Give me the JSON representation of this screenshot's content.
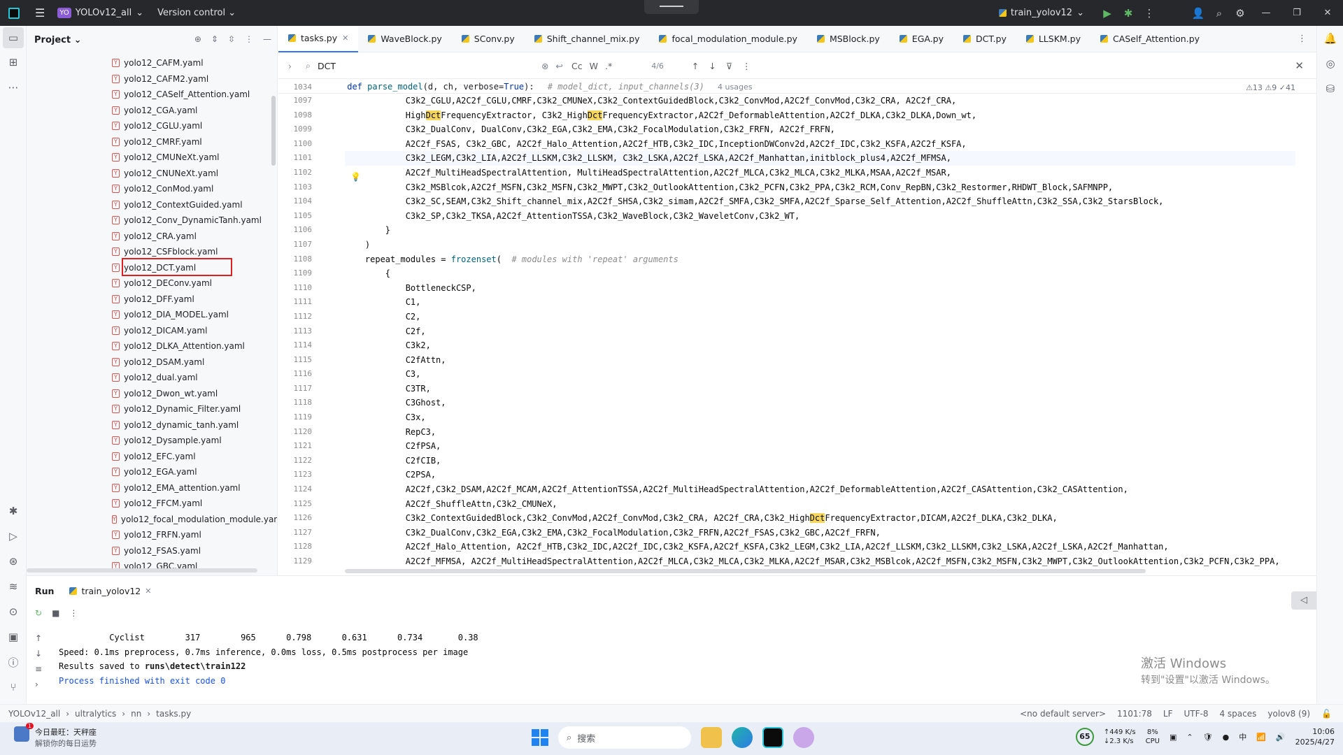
{
  "titlebar": {
    "project_badge": "YO",
    "project": "YOLOv12_all",
    "version_control": "Version control",
    "run_config": "train_yolov12"
  },
  "project_panel": {
    "title": "Project",
    "files": [
      "yolo12_CAFM.yaml",
      "yolo12_CAFM2.yaml",
      "yolo12_CASelf_Attention.yaml",
      "yolo12_CGA.yaml",
      "yolo12_CGLU.yaml",
      "yolo12_CMRF.yaml",
      "yolo12_CMUNeXt.yaml",
      "yolo12_CNUNeXt.yaml",
      "yolo12_ConMod.yaml",
      "yolo12_ContextGuided.yaml",
      "yolo12_Conv_DynamicTanh.yaml",
      "yolo12_CRA.yaml",
      "yolo12_CSFblock.yaml",
      "yolo12_DCT.yaml",
      "yolo12_DEConv.yaml",
      "yolo12_DFF.yaml",
      "yolo12_DIA_MODEL.yaml",
      "yolo12_DICAM.yaml",
      "yolo12_DLKA_Attention.yaml",
      "yolo12_DSAM.yaml",
      "yolo12_dual.yaml",
      "yolo12_Dwon_wt.yaml",
      "yolo12_Dynamic_Filter.yaml",
      "yolo12_dynamic_tanh.yaml",
      "yolo12_Dysample.yaml",
      "yolo12_EFC.yaml",
      "yolo12_EGA.yaml",
      "yolo12_EMA_attention.yaml",
      "yolo12_FFCM.yaml",
      "yolo12_focal_modulation_module.yaml",
      "yolo12_FRFN.yaml",
      "yolo12_FSAS.yaml",
      "yolo12_GBC.yaml"
    ]
  },
  "tabs": [
    "tasks.py",
    "WaveBlock.py",
    "SConv.py",
    "Shift_channel_mix.py",
    "focal_modulation_module.py",
    "MSBlock.py",
    "EGA.py",
    "DCT.py",
    "LLSKM.py",
    "CASelf_Attention.py"
  ],
  "search": {
    "query": "DCT",
    "count": "4/6",
    "cc": "Cc",
    "w": "W",
    "regex": ".*"
  },
  "editor": {
    "sticky_line": "1034",
    "sticky_def": "def",
    "sticky_fn": "parse_model",
    "sticky_args": "(d, ch, verbose=",
    "sticky_true": "True",
    "sticky_close": "):",
    "sticky_comment": "# model_dict, input_channels(3)",
    "usages": "4 usages",
    "inspections": "⚠13  ⚠9  ✓41",
    "line_numbers": [
      "1097",
      "1098",
      "1099",
      "1100",
      "1101",
      "1102",
      "1103",
      "1104",
      "1105",
      "1106",
      "1107",
      "1108",
      "1109",
      "1110",
      "1111",
      "1112",
      "1113",
      "1114",
      "1115",
      "1116",
      "1117",
      "1118",
      "1119",
      "1120",
      "1121",
      "1122",
      "1123",
      "1124",
      "1125",
      "1126",
      "1127",
      "1128",
      "1129"
    ],
    "lines": [
      "            C3k2_CGLU,A2C2f_CGLU,CMRF,C3k2_CMUNeX,C3k2_ContextGuidedBlock,C3k2_ConvMod,A2C2f_ConvMod,C3k2_CRA, A2C2f_CRA,",
      "            HighDctFrequencyExtractor, C3k2_HighDctFrequencyExtractor,A2C2f_DeformableAttention,A2C2f_DLKA,C3k2_DLKA,Down_wt,",
      "            C3k2_DualConv, DualConv,C3k2_EGA,C3k2_EMA,C3k2_FocalModulation,C3k2_FRFN, A2C2f_FRFN,",
      "            A2C2f_FSAS, C3k2_GBC, A2C2f_Halo_Attention,A2C2f_HTB,C3k2_IDC,InceptionDWConv2d,A2C2f_IDC,C3k2_KSFA,A2C2f_KSFA,",
      "            C3k2_LEGM,C3k2_LIA,A2C2f_LLSKM,C3k2_LLSKM, C3k2_LSKA,A2C2f_LSKA,A2C2f_Manhattan,initblock_plus4,A2C2f_MFMSA,",
      "            A2C2f_MultiHeadSpectralAttention, MultiHeadSpectralAttention,A2C2f_MLCA,C3k2_MLCA,C3k2_MLKA,MSAA,A2C2f_MSAR,",
      "            C3k2_MSBlcok,A2C2f_MSFN,C3k2_MSFN,C3k2_MWPT,C3k2_OutlookAttention,C3k2_PCFN,C3k2_PPA,C3k2_RCM,Conv_RepBN,C3k2_Restormer,RHDWT_Block,SAFMNPP,",
      "            C3k2_SC,SEAM,C3k2_Shift_channel_mix,A2C2f_SHSA,C3k2_simam,A2C2f_SMFA,C3k2_SMFA,A2C2f_Sparse_Self_Attention,A2C2f_ShuffleAttn,C3k2_SSA,C3k2_StarsBlock,",
      "            C3k2_SP,C3k2_TKSA,A2C2f_AttentionTSSA,C3k2_WaveBlock,C3k2_WaveletConv,C3k2_WT,",
      "        }",
      "    )",
      "    repeat_modules = frozenset(  # modules with 'repeat' arguments",
      "        {",
      "            BottleneckCSP,",
      "            C1,",
      "            C2,",
      "            C2f,",
      "            C3k2,",
      "            C2fAttn,",
      "            C3,",
      "            C3TR,",
      "            C3Ghost,",
      "            C3x,",
      "            RepC3,",
      "            C2fPSA,",
      "            C2fCIB,",
      "            C2PSA,",
      "            A2C2f,C3k2_DSAM,A2C2f_MCAM,A2C2f_AttentionTSSA,A2C2f_MultiHeadSpectralAttention,A2C2f_DeformableAttention,A2C2f_CASAttention,C3k2_CASAttention,",
      "            A2C2f_ShuffleAttn,C3k2_CMUNeX,",
      "            C3k2_ContextGuidedBlock,C3k2_ConvMod,A2C2f_ConvMod,C3k2_CRA, A2C2f_CRA,C3k2_HighDctFrequencyExtractor,DICAM,A2C2f_DLKA,C3k2_DLKA,",
      "            C3k2_DualConv,C3k2_EGA,C3k2_EMA,C3k2_FocalModulation,C3k2_FRFN,A2C2f_FSAS,C3k2_GBC,A2C2f_FRFN,",
      "            A2C2f_Halo_Attention, A2C2f_HTB,C3k2_IDC,A2C2f_IDC,C3k2_KSFA,A2C2f_KSFA,C3k2_LEGM,C3k2_LIA,A2C2f_LLSKM,C3k2_LLSKM,C3k2_LSKA,A2C2f_LSKA,A2C2f_Manhattan,",
      "            A2C2f_MFMSA, A2C2f_MultiHeadSpectralAttention,A2C2f_MLCA,C3k2_MLCA,C3k2_MLKA,A2C2f_MSAR,C3k2_MSBlcok,A2C2f_MSFN,C3k2_MSFN,C3k2_MWPT,C3k2_OutlookAttention,C3k2_PCFN,C3k2_PPA,"
    ]
  },
  "run_panel": {
    "run_label": "Run",
    "tab": "train_yolov12",
    "console": [
      "          Cyclist        317        965      0.798      0.631      0.734       0.38",
      "Speed: 0.1ms preprocess, 0.7ms inference, 0.0ms loss, 0.5ms postprocess per image",
      "Results saved to ",
      "runs\\detect\\train122",
      "",
      "Process finished with exit code 0"
    ],
    "watermark_title": "激活 Windows",
    "watermark_sub": "转到\"设置\"以激活 Windows。"
  },
  "statusbar": {
    "crumbs": [
      "YOLOv12_all",
      "ultralytics",
      "nn",
      "tasks.py"
    ],
    "server": "<no default server>",
    "pos": "1101:78",
    "eol": "LF",
    "encoding": "UTF-8",
    "indent": "4 spaces",
    "interpreter": "yolov8 (9)"
  },
  "taskbar": {
    "news_title": "今日最旺：天秤座",
    "news_sub": "解锁你的每日运势",
    "news_badge": "1",
    "search": "搜索",
    "cpu_temp": "65",
    "net_up": "↑449 K/s",
    "net_down": "↓2.3 K/s",
    "cpu": "8%",
    "cpu_label": "CPU",
    "ime": "中",
    "time": "10:06",
    "date": "2025/4/27"
  }
}
